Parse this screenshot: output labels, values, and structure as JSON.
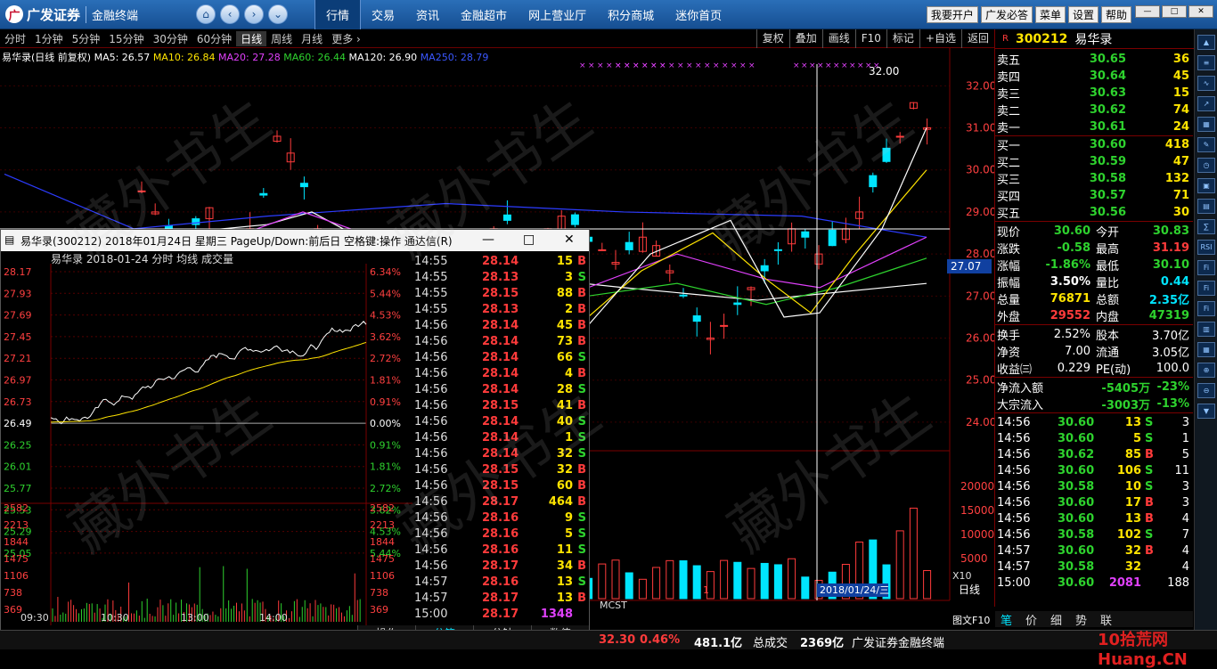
{
  "app": {
    "logo_text": "广发证券",
    "sub_title": "金融终端"
  },
  "menu": [
    "行情",
    "交易",
    "资讯",
    "金融超市",
    "网上营业厅",
    "积分商城",
    "迷你首页"
  ],
  "menu_active": 0,
  "right_buttons": [
    "我要开户",
    "广发必答",
    "菜单",
    "设置",
    "帮助"
  ],
  "periods": [
    "分时",
    "1分钟",
    "5分钟",
    "15分钟",
    "30分钟",
    "60分钟",
    "日线",
    "周线",
    "月线",
    "更多 ›"
  ],
  "period_active": 6,
  "tools": [
    "复权",
    "叠加",
    "画线",
    "F10",
    "标记",
    "+自选",
    "返回"
  ],
  "ma_line": {
    "name": "易华录(日线 前复权)",
    "ma5": "MA5: 26.57",
    "ma10": "MA10: 26.84",
    "ma20": "MA20: 27.28",
    "ma60": "MA60: 26.44",
    "ma120": "MA120: 26.90",
    "ma250": "MA250: 28.79"
  },
  "chart_labels": {
    "y_ticks": [
      "32.00",
      "31.00",
      "30.00",
      "29.00",
      "28.00",
      "27.00",
      "26.00",
      "25.00",
      "24.00"
    ],
    "current_price": "27.07",
    "high_mark": "32.00",
    "vol_ticks": [
      "20000",
      "15000",
      "10000",
      "5000"
    ],
    "vol_unit": "X10",
    "date_tag": "2018/01/24/三",
    "month_tag": "1",
    "mcst": "MCST",
    "daily_tab": "日线",
    "f10_tab": "图文F10"
  },
  "quote": {
    "code": "300212",
    "name": "易华录",
    "asks": [
      {
        "label": "卖五",
        "price": "30.65",
        "vol": "36"
      },
      {
        "label": "卖四",
        "price": "30.64",
        "vol": "45"
      },
      {
        "label": "卖三",
        "price": "30.63",
        "vol": "15"
      },
      {
        "label": "卖二",
        "price": "30.62",
        "vol": "74"
      },
      {
        "label": "卖一",
        "price": "30.61",
        "vol": "24"
      }
    ],
    "bids": [
      {
        "label": "买一",
        "price": "30.60",
        "vol": "418"
      },
      {
        "label": "买二",
        "price": "30.59",
        "vol": "47"
      },
      {
        "label": "买三",
        "price": "30.58",
        "vol": "132"
      },
      {
        "label": "买四",
        "price": "30.57",
        "vol": "71"
      },
      {
        "label": "买五",
        "price": "30.56",
        "vol": "30"
      }
    ],
    "stats": [
      {
        "l1": "现价",
        "v1": "30.60",
        "c1": "grn",
        "l2": "今开",
        "v2": "30.83",
        "c2": "grn"
      },
      {
        "l1": "涨跌",
        "v1": "-0.58",
        "c1": "grn",
        "l2": "最高",
        "v2": "31.19",
        "c2": "red"
      },
      {
        "l1": "涨幅",
        "v1": "-1.86%",
        "c1": "grn",
        "l2": "最低",
        "v2": "30.10",
        "c2": "grn"
      },
      {
        "l1": "振幅",
        "v1": "3.50%",
        "c1": "wht",
        "l2": "量比",
        "v2": "0.44",
        "c2": "cyn"
      },
      {
        "l1": "总量",
        "v1": "76871",
        "c1": "yel",
        "l2": "总额",
        "v2": "2.35亿",
        "c2": "cyn"
      },
      {
        "l1": "外盘",
        "v1": "29552",
        "c1": "red",
        "l2": "内盘",
        "v2": "47319",
        "c2": "grn"
      }
    ],
    "stats2": [
      {
        "l1": "换手",
        "v1": "2.52%",
        "l2": "股本",
        "v2": "3.70亿"
      },
      {
        "l1": "净资",
        "v1": "7.00",
        "l2": "流通",
        "v2": "3.05亿"
      },
      {
        "l1": "收益㈢",
        "v1": "0.229",
        "l2": "PE(动)",
        "v2": "100.0"
      }
    ],
    "flows": [
      {
        "label": "净流入额",
        "value": "-5405万",
        "pct": "-23%"
      },
      {
        "label": "大宗流入",
        "value": "-3003万",
        "pct": "-13%"
      }
    ],
    "ticks": [
      {
        "t": "14:56",
        "p": "30.60",
        "pc": "grn",
        "v": "13",
        "d": "S",
        "n": "3"
      },
      {
        "t": "14:56",
        "p": "30.60",
        "pc": "grn",
        "v": "5",
        "d": "S",
        "n": "1"
      },
      {
        "t": "14:56",
        "p": "30.62",
        "pc": "grn",
        "v": "85",
        "d": "B",
        "n": "5"
      },
      {
        "t": "14:56",
        "p": "30.60",
        "pc": "grn",
        "v": "106",
        "d": "S",
        "n": "11"
      },
      {
        "t": "14:56",
        "p": "30.58",
        "pc": "grn",
        "v": "10",
        "d": "S",
        "n": "3"
      },
      {
        "t": "14:56",
        "p": "30.60",
        "pc": "grn",
        "v": "17",
        "d": "B",
        "n": "3"
      },
      {
        "t": "14:56",
        "p": "30.60",
        "pc": "grn",
        "v": "13",
        "d": "B",
        "n": "4"
      },
      {
        "t": "14:56",
        "p": "30.58",
        "pc": "grn",
        "v": "102",
        "d": "S",
        "n": "7"
      },
      {
        "t": "14:57",
        "p": "30.60",
        "pc": "grn",
        "v": "32",
        "d": "B",
        "n": "4"
      },
      {
        "t": "14:57",
        "p": "30.58",
        "pc": "grn",
        "v": "32",
        "d": "",
        "n": "4"
      },
      {
        "t": "15:00",
        "p": "30.60",
        "pc": "grn",
        "v": "2081",
        "d": "",
        "n": "188"
      }
    ],
    "tabs": [
      "笔",
      "价",
      "细",
      "势",
      "联"
    ]
  },
  "popup": {
    "title": "易华录(300212) 2018年01月24日 星期三 PageUp/Down:前后日 空格键:操作 通达信(R)",
    "header": "易华录   2018-01-24 分时 均线 成交量",
    "price_ticks": [
      "28.17",
      "27.93",
      "27.69",
      "27.45",
      "27.21",
      "26.97",
      "26.73",
      "26.49",
      "26.25",
      "26.01",
      "25.77",
      "25.53",
      "25.29",
      "25.05"
    ],
    "pct_ticks": [
      "6.34%",
      "5.44%",
      "4.53%",
      "3.62%",
      "2.72%",
      "1.81%",
      "0.91%",
      "0.00%",
      "0.91%",
      "1.81%",
      "2.72%",
      "3.62%",
      "4.53%",
      "5.44%"
    ],
    "vol_ticks": [
      "2582",
      "2213",
      "1844",
      "1475",
      "1106",
      "738",
      "369"
    ],
    "time_ticks": [
      "09:30",
      "10:30",
      "13:00",
      "14:00"
    ],
    "trades": [
      {
        "t": "14:55",
        "p": "28.14",
        "v": "15",
        "d": "B"
      },
      {
        "t": "14:55",
        "p": "28.13",
        "v": "3",
        "d": "S"
      },
      {
        "t": "14:55",
        "p": "28.15",
        "v": "88",
        "d": "B"
      },
      {
        "t": "14:55",
        "p": "28.13",
        "v": "2",
        "d": "B"
      },
      {
        "t": "14:56",
        "p": "28.14",
        "v": "45",
        "d": "B"
      },
      {
        "t": "14:56",
        "p": "28.14",
        "v": "73",
        "d": "B"
      },
      {
        "t": "14:56",
        "p": "28.14",
        "v": "66",
        "d": "S"
      },
      {
        "t": "14:56",
        "p": "28.14",
        "v": "4",
        "d": "B"
      },
      {
        "t": "14:56",
        "p": "28.14",
        "v": "28",
        "d": "S"
      },
      {
        "t": "14:56",
        "p": "28.15",
        "v": "41",
        "d": "B"
      },
      {
        "t": "14:56",
        "p": "28.14",
        "v": "40",
        "d": "S"
      },
      {
        "t": "14:56",
        "p": "28.14",
        "v": "1",
        "d": "S"
      },
      {
        "t": "14:56",
        "p": "28.14",
        "v": "32",
        "d": "S"
      },
      {
        "t": "14:56",
        "p": "28.15",
        "v": "32",
        "d": "B"
      },
      {
        "t": "14:56",
        "p": "28.15",
        "v": "60",
        "d": "B"
      },
      {
        "t": "14:56",
        "p": "28.17",
        "v": "464",
        "d": "B"
      },
      {
        "t": "14:56",
        "p": "28.16",
        "v": "9",
        "d": "S"
      },
      {
        "t": "14:56",
        "p": "28.16",
        "v": "5",
        "d": "S"
      },
      {
        "t": "14:56",
        "p": "28.16",
        "v": "11",
        "d": "S"
      },
      {
        "t": "14:56",
        "p": "28.17",
        "v": "34",
        "d": "B"
      },
      {
        "t": "14:57",
        "p": "28.16",
        "v": "13",
        "d": "S"
      },
      {
        "t": "14:57",
        "p": "28.17",
        "v": "13",
        "d": "B"
      },
      {
        "t": "15:00",
        "p": "28.17",
        "v": "1348",
        "d": ""
      }
    ],
    "footer": [
      "操作",
      "分笔",
      "分钟",
      "数值"
    ]
  },
  "status": {
    "index_val": "32.30",
    "index_pct": "0.46%",
    "amount": "481.1亿",
    "total_label": "总成交",
    "total_val": "2369亿",
    "broker": "广发证券金融终端"
  },
  "watermark": "藏外书生",
  "site_badge": "10拾荒网 Huang.CN"
}
